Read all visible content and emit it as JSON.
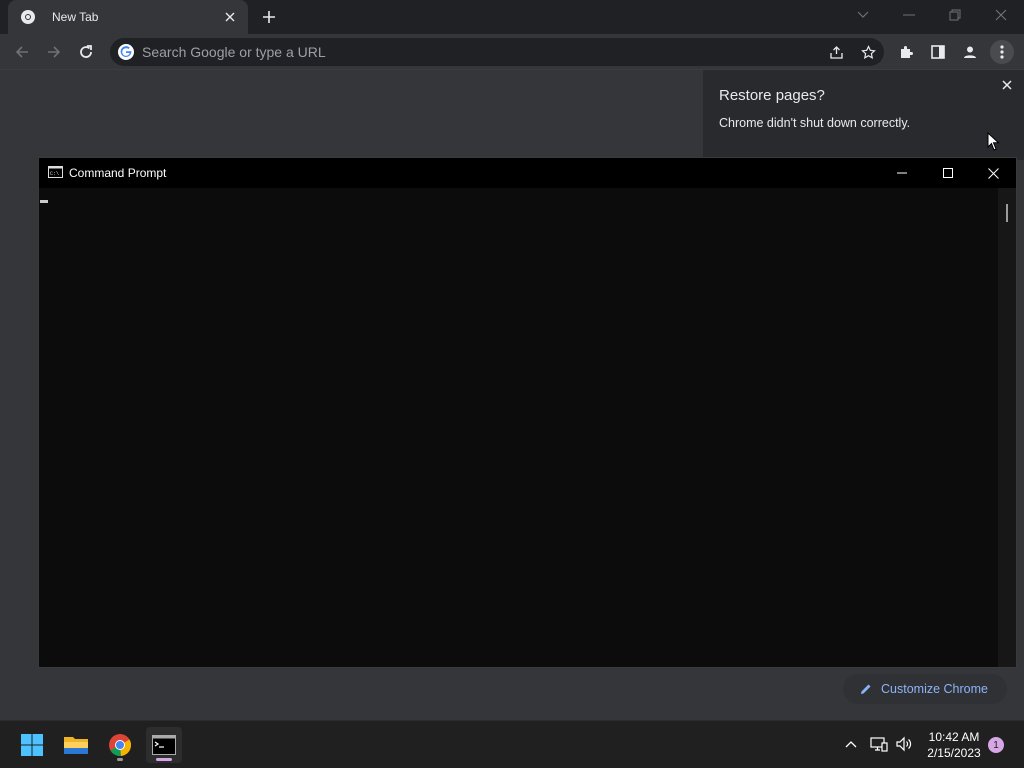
{
  "browser": {
    "tab_title": "New Tab",
    "omnibox_placeholder": "Search Google or type a URL",
    "restore_bubble": {
      "heading": "Restore pages?",
      "text": "Chrome didn't shut down correctly."
    },
    "customize_label": "Customize Chrome",
    "icons": [
      "chrome-icon",
      "close-icon",
      "plus-icon",
      "back-icon",
      "forward-icon",
      "reload-icon",
      "google-icon",
      "share-icon",
      "star-icon",
      "extensions-icon",
      "side-panel-icon",
      "profile-icon",
      "menu-icon",
      "pencil-icon"
    ]
  },
  "cmd_window": {
    "title": "Command Prompt"
  },
  "taskbar": {
    "time": "10:42 AM",
    "date": "2/15/2023",
    "notification_count": "1",
    "apps": [
      "windows-start-icon",
      "file-explorer-icon",
      "chrome-icon",
      "command-prompt-icon"
    ]
  },
  "colors": {
    "accent": "#8ab4f8",
    "chrome_dark": "#202124",
    "toolbar": "#35363a",
    "terminal_bg": "#0c0c0c"
  }
}
